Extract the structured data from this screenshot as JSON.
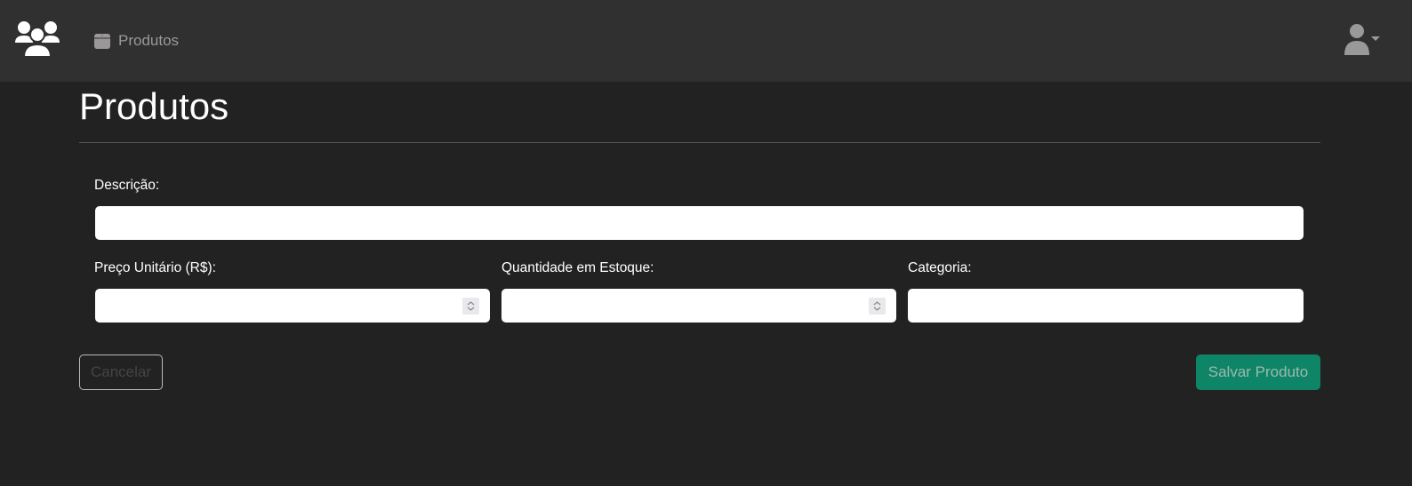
{
  "navbar": {
    "logo_icon": "users-icon",
    "links": [
      {
        "label": "Produtos",
        "icon": "box-icon"
      }
    ],
    "user_icon": "user-icon"
  },
  "page": {
    "title": "Produtos"
  },
  "form": {
    "descricao": {
      "label": "Descrição:",
      "value": ""
    },
    "preco": {
      "label": "Preço Unitário (R$):",
      "value": ""
    },
    "quantidade": {
      "label": "Quantidade em Estoque:",
      "value": ""
    },
    "categoria": {
      "label": "Categoria:",
      "value": ""
    }
  },
  "buttons": {
    "cancel": "Cancelar",
    "save": "Salvar Produto"
  },
  "colors": {
    "navbar": "#303030",
    "background": "#222222",
    "save_button": "#0d8566"
  }
}
